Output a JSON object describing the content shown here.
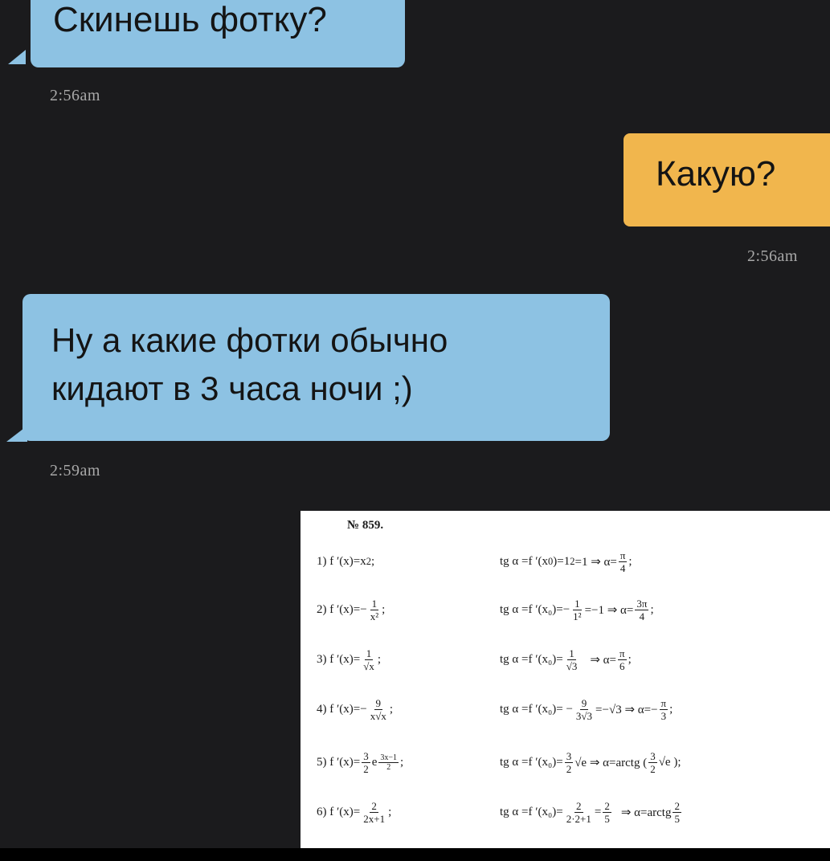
{
  "messages": [
    {
      "side": "incoming",
      "text": "Скинешь фотку?",
      "time": "2:56am"
    },
    {
      "side": "outgoing",
      "text": "Какую?",
      "time": "2:56am"
    },
    {
      "side": "incoming",
      "line1": "Ну а какие фотки обычно",
      "line2": "кидают в 3 часа ночи ;)",
      "time": "2:59am"
    }
  ],
  "attachment": {
    "title": "№ 859.",
    "rows": [
      {
        "lhs": [
          "1) f ′(x)=x",
          "2",
          ";"
        ],
        "rhs": [
          "tg α =f ′(x",
          "0",
          ")=1",
          "2",
          "=1 ⇒ α=",
          "π",
          "4",
          ";"
        ]
      },
      {
        "lhs": [
          "2) f ′(x)=−",
          "1",
          "x²",
          ";"
        ],
        "rhs": [
          "tg α =f ′(x₀)=−",
          "1",
          "1²",
          "=−1 ⇒ α=",
          "3π",
          "4",
          ";"
        ]
      },
      {
        "lhs": [
          "3) f ′(x)=",
          "1",
          "√x",
          ";"
        ],
        "rhs": [
          "tg α =f ′(x₀)=",
          "1",
          "√3",
          "⇒ α=",
          "π",
          "6",
          ";"
        ]
      },
      {
        "lhs": [
          "4) f ′(x)=−",
          "9",
          "x√x",
          ";"
        ],
        "rhs": [
          "tg α =f ′(x₀)= −",
          "9",
          "3√3",
          "=−√3 ⇒ α=−",
          "π",
          "3",
          ";"
        ]
      },
      {
        "lhs": [
          "5) f ′(x)=",
          "3",
          "2",
          "e",
          "3x−1",
          "2",
          ";"
        ],
        "rhs": [
          "tg α =f ′(x₀)=",
          "3",
          "2",
          "√e ⇒ α=arctg (",
          "3",
          "2",
          "√e );"
        ]
      },
      {
        "lhs": [
          "6) f ′(x)=",
          "2",
          "2x+1",
          ";"
        ],
        "rhs": [
          "tg α =f ′(x₀)= ",
          "2",
          "2·2+1",
          "=",
          "2",
          "5",
          "⇒ α=arctg",
          "2",
          "5"
        ]
      }
    ]
  }
}
